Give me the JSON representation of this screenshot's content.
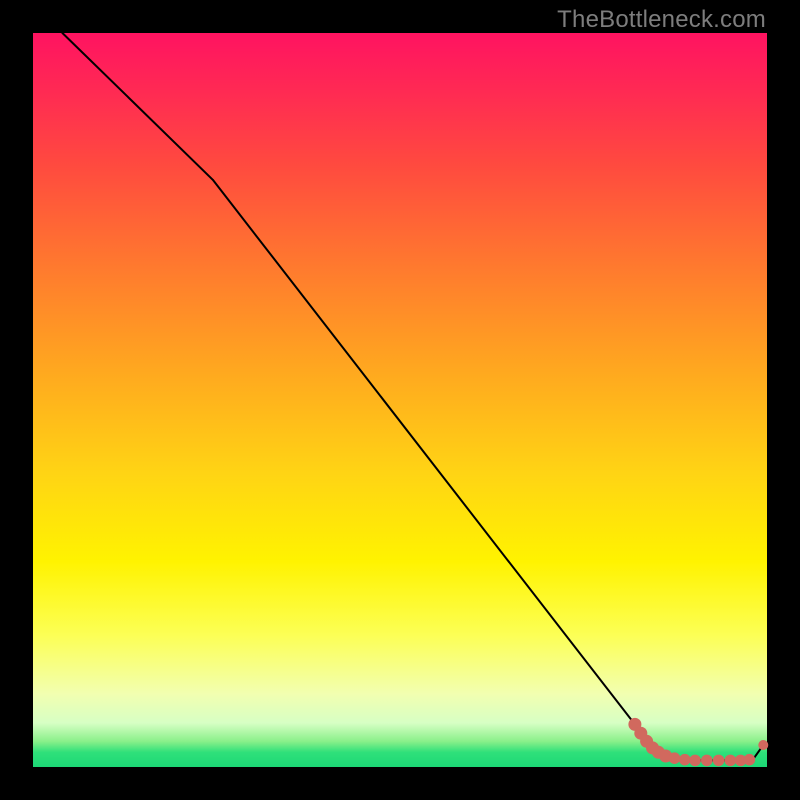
{
  "watermark": "TheBottleneck.com",
  "colors": {
    "line": "#000000",
    "marker": "#d1695e",
    "bg_black": "#000000"
  },
  "chart_data": {
    "type": "line",
    "title": "",
    "xlabel": "",
    "ylabel": "",
    "xlim": [
      0,
      100
    ],
    "ylim": [
      0,
      100
    ],
    "grid": false,
    "legend": false,
    "comment": "Curve points in percent of plot area (origin bottom-left). The thin black line descends steeply from top-left, bends near the bottom-right, and flattens along y≈1 with a small final uptick. A cluster of salmon-colored markers sits along the flat bottom-right segment.",
    "line_points_pct": [
      {
        "x": 4.0,
        "y": 100.0
      },
      {
        "x": 24.5,
        "y": 80.0
      },
      {
        "x": 82.0,
        "y": 5.8
      },
      {
        "x": 86.0,
        "y": 1.6
      },
      {
        "x": 90.0,
        "y": 0.9
      },
      {
        "x": 95.0,
        "y": 0.9
      },
      {
        "x": 98.0,
        "y": 0.9
      },
      {
        "x": 99.5,
        "y": 3.0
      }
    ],
    "markers_pct": [
      {
        "x": 82.0,
        "y": 5.8
      },
      {
        "x": 82.8,
        "y": 4.6
      },
      {
        "x": 83.6,
        "y": 3.5
      },
      {
        "x": 84.4,
        "y": 2.6
      },
      {
        "x": 85.2,
        "y": 2.0
      },
      {
        "x": 86.2,
        "y": 1.5
      },
      {
        "x": 87.4,
        "y": 1.2
      },
      {
        "x": 88.8,
        "y": 1.0
      },
      {
        "x": 90.2,
        "y": 0.9
      },
      {
        "x": 91.8,
        "y": 0.9
      },
      {
        "x": 93.4,
        "y": 0.9
      },
      {
        "x": 95.0,
        "y": 0.9
      },
      {
        "x": 96.4,
        "y": 0.9
      },
      {
        "x": 97.6,
        "y": 1.0
      },
      {
        "x": 99.5,
        "y": 3.0
      }
    ]
  }
}
